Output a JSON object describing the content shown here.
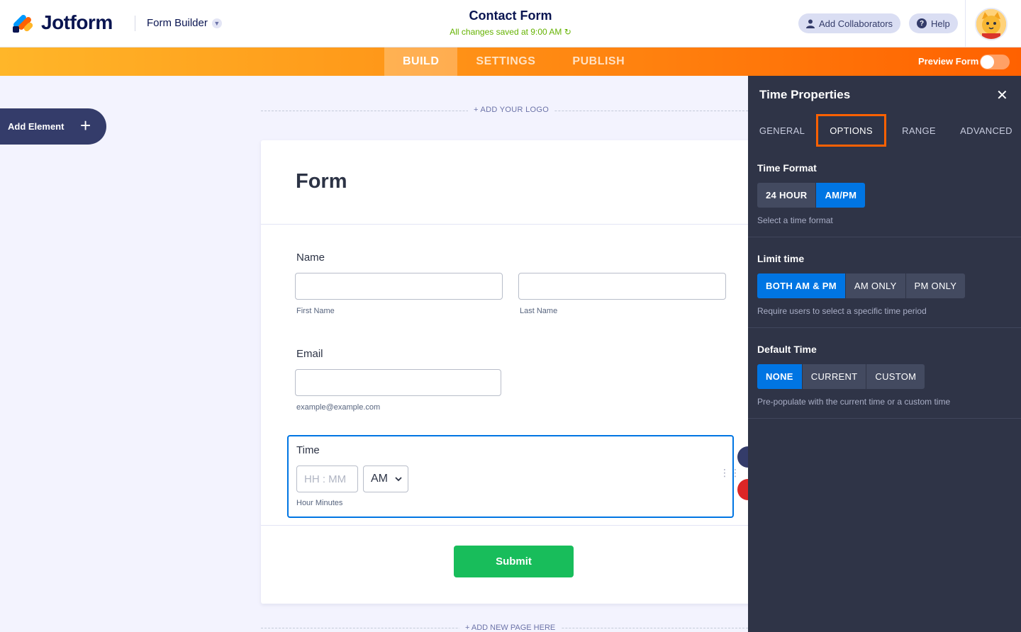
{
  "app": {
    "brand": "Jotform",
    "builder_menu": "Form Builder",
    "form_title": "Contact Form",
    "save_status": "All changes saved at 9:00 AM",
    "add_collaborators": "Add Collaborators",
    "help": "Help"
  },
  "nav": {
    "tabs": [
      "BUILD",
      "SETTINGS",
      "PUBLISH"
    ],
    "active_tab": "BUILD",
    "preview_label": "Preview Form",
    "preview_enabled": false
  },
  "canvas": {
    "add_element": "Add Element",
    "add_logo": "+ ADD YOUR LOGO",
    "form_heading": "Form",
    "name_label": "Name",
    "first_name_sub": "First Name",
    "last_name_sub": "Last Name",
    "email_label": "Email",
    "email_sub": "example@example.com",
    "time_label": "Time",
    "time_placeholder": "HH : MM",
    "ampm_value": "AM",
    "time_sub": "Hour Minutes",
    "submit": "Submit",
    "add_page": "+ ADD NEW PAGE HERE"
  },
  "panel": {
    "title": "Time Properties",
    "tabs": [
      "GENERAL",
      "OPTIONS",
      "RANGE",
      "ADVANCED"
    ],
    "active_tab": "OPTIONS",
    "time_format": {
      "heading": "Time Format",
      "options": [
        "24 HOUR",
        "AM/PM"
      ],
      "selected": "AM/PM",
      "hint": "Select a time format"
    },
    "limit_time": {
      "heading": "Limit time",
      "options": [
        "BOTH AM & PM",
        "AM ONLY",
        "PM ONLY"
      ],
      "selected": "BOTH AM & PM",
      "hint": "Require users to select a specific time period"
    },
    "default_time": {
      "heading": "Default Time",
      "options": [
        "NONE",
        "CURRENT",
        "CUSTOM"
      ],
      "selected": "NONE",
      "hint": "Pre-populate with the current time or a custom time"
    }
  },
  "colors": {
    "accent_orange": "#ff6100",
    "selected_blue": "#0075e3",
    "submit_green": "#18bd5b",
    "panel_bg": "#2f3447",
    "saved_green": "#64b200"
  }
}
